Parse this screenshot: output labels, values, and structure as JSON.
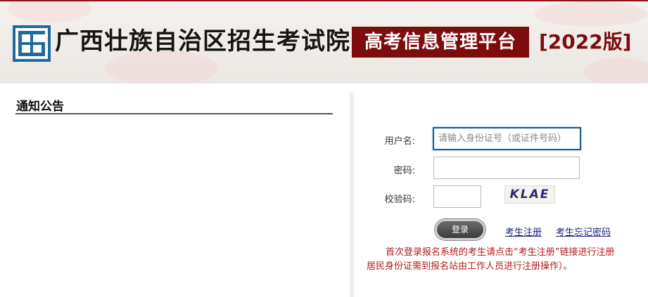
{
  "header": {
    "org_name": "广西壮族自治区招生考试院",
    "platform": "高考信息管理平台",
    "edition": "[2022版]"
  },
  "notice": {
    "title": "通知公告"
  },
  "login": {
    "username_label": "用户名:",
    "username_placeholder": "请输入身份证号（或证件号码）",
    "password_label": "密码:",
    "captcha_label": "校验码:",
    "captcha_text": "KLAE",
    "login_button": "登录",
    "register_link": "考生注册",
    "forgot_link": "考生忘记密码",
    "note_line1": "首次登录报名系统的考生请点击“考生注册”链接进行注册",
    "note_line2": "居民身份证需到报名站由工作人员进行注册操作）。"
  },
  "colors": {
    "brand_red": "#7d0d0d",
    "logo_blue": "#1e6c9e",
    "note_red": "#b51a1a",
    "link_blue": "#1a237e"
  },
  "icons": {
    "logo": "exam-authority-logo"
  }
}
